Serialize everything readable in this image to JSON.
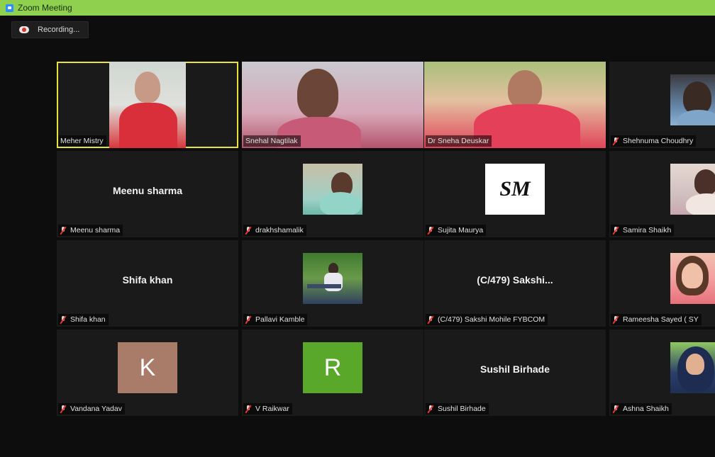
{
  "window": {
    "title": "Zoom Meeting"
  },
  "recording": {
    "label": "Recording..."
  },
  "participants": [
    {
      "name": "Meher Mistry",
      "display": "video",
      "active": true
    },
    {
      "name": "Snehal Nagtilak",
      "display": "video"
    },
    {
      "name": "Dr Sneha Deuskar",
      "display": "video"
    },
    {
      "name": "Shehnuma Choudhry",
      "display": "thumb",
      "muted": true
    },
    {
      "name": "Meenu sharma",
      "big_name": "Meenu sharma",
      "display": "name",
      "muted": true
    },
    {
      "name": "drakhshamalik",
      "display": "thumb",
      "muted": true
    },
    {
      "name": "Sujita Maurya",
      "avatar": "SM",
      "display": "avatar",
      "muted": true
    },
    {
      "name": "Samira Shaikh",
      "display": "thumb",
      "muted": true
    },
    {
      "name": "Shifa khan",
      "big_name": "Shifa khan",
      "display": "name",
      "muted": true
    },
    {
      "name": "Pallavi Kamble",
      "display": "thumb",
      "muted": true
    },
    {
      "name": "(C/479) Sakshi Mohile FYBCOM",
      "big_name": "(C/479)  Sakshi...",
      "display": "name",
      "muted": true
    },
    {
      "name": "Rameesha Sayed ( SY",
      "display": "thumb",
      "muted": true
    },
    {
      "name": "Vandana Yadav",
      "avatar": "K",
      "display": "avatar",
      "muted": true
    },
    {
      "name": "V Raikwar",
      "avatar": "R",
      "display": "avatar",
      "muted": true
    },
    {
      "name": "Sushil Birhade",
      "big_name": "Sushil Birhade",
      "display": "name",
      "muted": true
    },
    {
      "name": "Ashna Shaikh",
      "display": "thumb",
      "muted": true
    }
  ],
  "colors": {
    "active_speaker_border": "#e8e33a",
    "titlebar": "#8fd14f",
    "avatar_k": "#a97c6a",
    "avatar_r": "#5aa82a",
    "mute_red": "#e8382f"
  }
}
